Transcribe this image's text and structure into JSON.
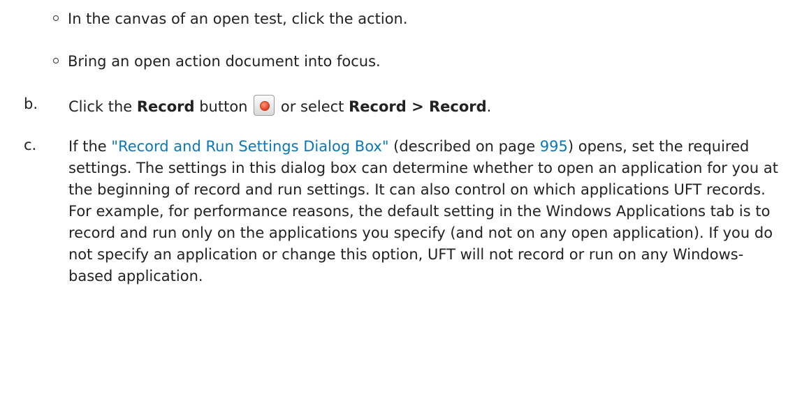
{
  "sub_items": [
    "In the canvas of an open test, click the action.",
    "Bring an open action document into focus."
  ],
  "step_b": {
    "marker": "b.",
    "text_1": "Click the ",
    "bold_1": "Record",
    "text_2": " button ",
    "icon": "record-button-icon",
    "text_3": " or select ",
    "bold_2": "Record > Record",
    "text_4": "."
  },
  "step_c": {
    "marker": "c.",
    "text_1": "If the ",
    "link": "\"Record and Run Settings Dialog Box\"",
    "text_2": " (described on page ",
    "page_link": "995",
    "text_3": ") opens, set the required settings. The settings in this dialog box can determine whether to open an application for you at the beginning of record and run settings. It can also control on which applications UFT records. For example, for performance reasons, the default setting in the Windows Applications tab is to record and run only on the applications you specify (and not on any open application). If you do not specify an application or change this option, UFT will not record or run on any Windows-based application."
  },
  "colors": {
    "text": "#222222",
    "link": "#0a78b8"
  }
}
